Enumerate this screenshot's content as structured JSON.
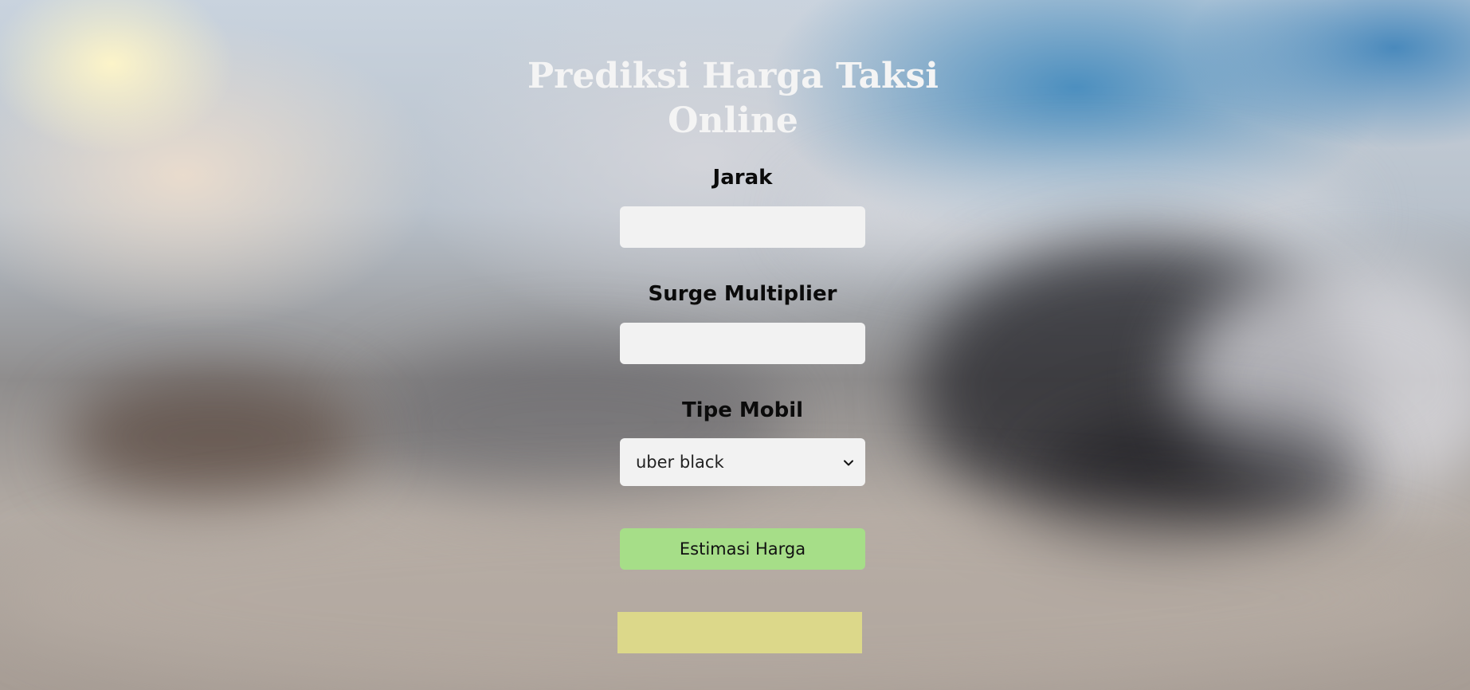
{
  "page": {
    "title": "Prediksi Harga Taksi Online"
  },
  "form": {
    "distance": {
      "label": "Jarak",
      "value": ""
    },
    "surge": {
      "label": "Surge Multiplier",
      "value": ""
    },
    "car_type": {
      "label": "Tipe Mobil",
      "selected": "uber black"
    },
    "submit_label": "Estimasi Harga"
  },
  "result": {
    "text": ""
  },
  "icons": {
    "select_arrow": "chevron-down-icon"
  },
  "colors": {
    "button_bg": "#a6de88",
    "result_bg": "#dcd88a",
    "input_bg": "#f2f2f2",
    "title_color": "#f4f4f4"
  }
}
